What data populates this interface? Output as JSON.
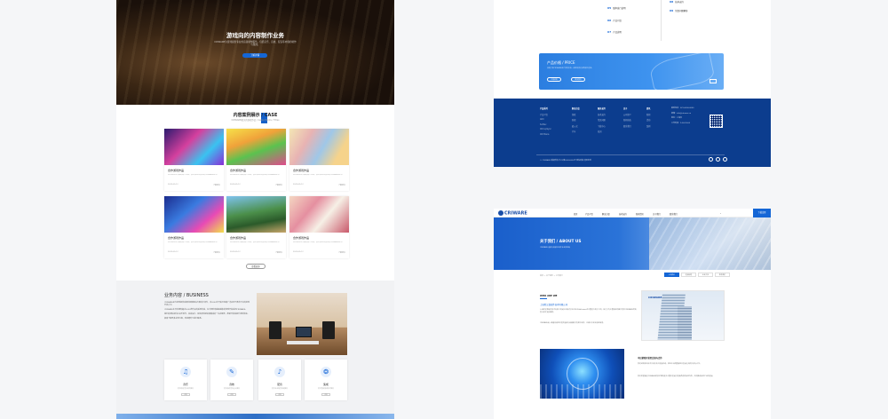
{
  "left_page": {
    "hero": {
      "title": "游戏向的内容制作业务",
      "subtitle": "CRIWARE为游戏提供专业的音频制作服务，包括音乐、音效、配音等内容的制作与集成。",
      "button": "了解详情"
    },
    "case": {
      "title": "内容案例展示 / CASE",
      "subtitle": "CRIWARE相关的游戏作品 / Game Works / Titles",
      "cards": [
        {
          "title": "合作游戏作品",
          "desc": "这里是游戏作品的简介内容，展示该游戏使用的CRIWARE技术。",
          "more": "了解更多",
          "date": "2023-05-12"
        },
        {
          "title": "合作游戏作品",
          "desc": "这里是游戏作品的简介内容，展示该游戏使用的CRIWARE技术。",
          "more": "了解更多",
          "date": "2023-05-12"
        },
        {
          "title": "合作游戏作品",
          "desc": "这里是游戏作品的简介内容，展示该游戏使用的CRIWARE技术。",
          "more": "了解更多",
          "date": "2023-05-12"
        },
        {
          "title": "合作游戏作品",
          "desc": "这里是游戏作品的简介内容，展示该游戏使用的CRIWARE技术。",
          "more": "了解更多",
          "date": "2023-05-12"
        },
        {
          "title": "合作游戏作品",
          "desc": "这里是游戏作品的简介内容，展示该游戏使用的CRIWARE技术。",
          "more": "了解更多",
          "date": "2023-05-12"
        },
        {
          "title": "合作游戏作品",
          "desc": "这里是游戏作品的简介内容，展示该游戏使用的CRIWARE技术。",
          "more": "了解更多",
          "date": "2023-05-12"
        }
      ],
      "more_button": "查看更多"
    },
    "business": {
      "title": "业务内容 / BUSINESS",
      "paragraphs": [
        "CRIWARE是为游戏提供音频和视频解决方案的中间件，自2000年开始已经被广泛应用于各种平台的游戏开发之中。",
        "CRIWARE在日本拥有超过5000款作品的采用实绩，在中国也有越来越多的游戏开始采用CRIWARE。",
        "我们的团队提供从音乐制作、音效设计、配音录制到音频集成的一站式服务，帮助开发者提升游戏体验。",
        "如需了解更多业务内容，欢迎随时与我们联系。"
      ],
      "services": [
        {
          "label": "音乐",
          "desc": "提供原创音乐制作服务",
          "btn": "详情"
        },
        {
          "label": "音效",
          "desc": "提供游戏音效设计服务",
          "btn": "详情"
        },
        {
          "label": "配音",
          "desc": "提供专业配音录制服务",
          "btn": "详情"
        },
        {
          "label": "集成",
          "desc": "提供音频集成技术服务",
          "btn": "详情"
        }
      ]
    }
  },
  "right_top_page": {
    "list_items": [
      {
        "num": "05",
        "label": "版本发行说明"
      },
      {
        "num": "06",
        "label": "产品介绍"
      },
      {
        "num": "07",
        "label": "产品说明"
      },
      {
        "num": "08",
        "label": "技术支持"
      },
      {
        "num": "09",
        "label": "常见问题解答"
      }
    ],
    "price": {
      "title": "产品价格 / PRICE",
      "desc": "如需了解CRIWARE各产品的价格，请联系我们获取报价信息。",
      "btn1": "立即咨询",
      "btn2": "联系我们"
    },
    "footer": {
      "columns": [
        {
          "heading": "产品系列",
          "items": [
            "产品介绍",
            "ADX",
            "Sofdec",
            "CRI LipSync",
            "CRI Mana"
          ]
        },
        {
          "heading": "解决方案",
          "items": [
            "游戏",
            "影视",
            "嵌入式",
            "汽车"
          ]
        },
        {
          "heading": "服务支持",
          "items": [
            "技术支持",
            "常见问题",
            "下载中心",
            "培训"
          ]
        },
        {
          "heading": "关于",
          "items": [
            "公司简介",
            "新闻动态",
            "联系我们"
          ]
        },
        {
          "heading": "资讯",
          "items": [
            "新闻",
            "活动",
            "案例"
          ]
        }
      ],
      "contact": [
        "联系电话：021-0000-0000",
        "邮箱：info@criware.cn",
        "地址：上海市",
        "工作时间：9:00-18:00"
      ],
      "copyright": "© CRIWARE 版权所有      沪ICP备00000000号      隐私政策      使用条款"
    }
  },
  "right_bottom_page": {
    "logo": "CRIWARE",
    "nav_items": [
      "首页",
      "产品介绍",
      "解决方案",
      "技术支持",
      "新闻资讯",
      "关于我们",
      "联系我们"
    ],
    "nav_cta": "下载试用",
    "banner": {
      "title": "关于我们 / ABOUT US",
      "subtitle": "CRIWARE 音频与视频中间件专业供应商"
    },
    "breadcrumb": "首页 > 关于我们 > 公司简介",
    "tabs": [
      "公司简介",
      "发展历程",
      "企业文化",
      "联系我们"
    ],
    "who_title": "WHO ARE WE",
    "company_name": "上海希艾维软件技术有限公司",
    "paragraphs": [
      "上海希艾维软件技术有限公司是日本株式会社CRI·Middleware在中国设立的子公司，致力于为中国地区的客户提供CRIWARE的销售与技术支持服务。",
      "CRIWARE是一款面向游戏开发的音频与视频解决方案中间件，已被众多知名游戏采用。"
    ],
    "image_logo": "CRIWARE",
    "right_heading": "中日游戏开发者交流与合作",
    "right_paragraphs": [
      "我们定期举办技术交流会及开发者活动，促进中日两国游戏开发者之间的交流与合作。",
      "我们希望通过CRIWARE的技术帮助更多中国开发者打造高品质的游戏作品，共同推动游戏产业的发展。"
    ]
  }
}
